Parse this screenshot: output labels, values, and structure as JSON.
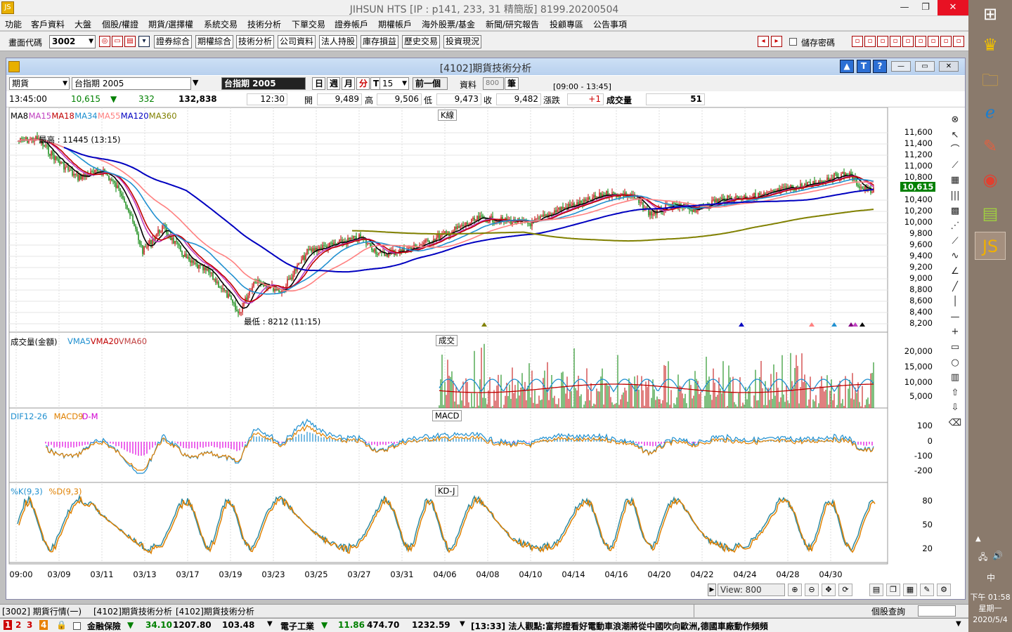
{
  "app": {
    "title": "JIHSUN HTS     [IP : p141, 233, 31 精簡版] 8199.20200504"
  },
  "menu": [
    "功能",
    "客戶資料",
    "大盤",
    "個股/權證",
    "期貨/選擇權",
    "系統交易",
    "技術分析",
    "下單交易",
    "證券帳戶",
    "期權帳戶",
    "海外股票/基金",
    "新聞/研究報告",
    "投顧專區",
    "公告事項"
  ],
  "toolbar": {
    "code_label": "畫面代碼",
    "code_value": "3002",
    "buttons": [
      "證券綜合",
      "期權綜合",
      "技術分析",
      "公司資料",
      "法人持股",
      "庫存損益",
      "歷史交易",
      "投資現況"
    ],
    "save_pwd": "儲存密碼"
  },
  "window": {
    "title": "[4102]期貨技術分析"
  },
  "controls": {
    "type": "期貨",
    "symbol": "台指期 2005",
    "symbol_name": "台指期 2005",
    "periods": [
      "日",
      "週",
      "月",
      "分",
      "T"
    ],
    "minutes": "15",
    "prev": "前一個",
    "data_label": "資料",
    "data_count": "800",
    "unit": "筆",
    "session": "[09:00 - 13:45]"
  },
  "quote": {
    "time": "13:45:00",
    "price": "10,615",
    "arrow": "▼",
    "change": "332",
    "volume": "132,838",
    "bar_time": "12:30",
    "open_lbl": "開",
    "open": "9,489",
    "high_lbl": "高",
    "high": "9,506",
    "low_lbl": "低",
    "low": "9,473",
    "close_lbl": "收",
    "close": "9,482",
    "chg_lbl": "漲跌",
    "chg": "+1",
    "vol_lbl": "成交量",
    "vol": "51"
  },
  "panels": {
    "k": {
      "title": "K線",
      "legend": [
        {
          "name": "MA8",
          "color": "#000000"
        },
        {
          "name": "MA15",
          "color": "#c040c0"
        },
        {
          "name": "MA18",
          "color": "#c00000"
        },
        {
          "name": "MA34",
          "color": "#2090d0"
        },
        {
          "name": "MA55",
          "color": "#ff8080"
        },
        {
          "name": "MA120",
          "color": "#0000c0"
        },
        {
          "name": "MA360",
          "color": "#808000"
        }
      ],
      "high_note": "最高 : 11445 (13:15)",
      "low_note": "最低 : 8212 (11:15)",
      "price_tag": "10,615",
      "yticks": [
        "11,600",
        "11,400",
        "11,200",
        "11,000",
        "10,800",
        "10,400",
        "10,200",
        "10,000",
        "9,800",
        "9,600",
        "9,400",
        "9,200",
        "9,000",
        "8,800",
        "8,600",
        "8,400",
        "8,200"
      ]
    },
    "vol": {
      "title": "成交",
      "legend": [
        {
          "name": "成交量(金額)",
          "color": "#000000"
        },
        {
          "name": "VMA5",
          "color": "#2090d0"
        },
        {
          "name": "VMA20",
          "color": "#c00000"
        },
        {
          "name": "VMA60",
          "color": "#c04040"
        }
      ],
      "yticks": [
        "20,000",
        "15,000",
        "10,000",
        "5,000"
      ]
    },
    "macd": {
      "title": "MACD",
      "legend": [
        {
          "name": "DIF12-26",
          "color": "#2090d0"
        },
        {
          "name": "MACD9",
          "color": "#e08000"
        },
        {
          "name": "D-M",
          "color": "#d000d0"
        }
      ],
      "yticks": [
        "100",
        "0",
        "-100",
        "-200"
      ]
    },
    "kd": {
      "title": "KD-J",
      "legend": [
        {
          "name": "%K(9,3)",
          "color": "#2090d0"
        },
        {
          "name": "%D(9,3)",
          "color": "#e08000"
        }
      ],
      "yticks": [
        "80",
        "50",
        "20"
      ]
    }
  },
  "xticks": [
    "09:00",
    "03/09",
    "03/11",
    "03/13",
    "03/17",
    "03/19",
    "03/23",
    "03/25",
    "03/27",
    "03/31",
    "04/06",
    "04/08",
    "04/10",
    "04/14",
    "04/16",
    "04/20",
    "04/22",
    "04/24",
    "04/28",
    "04/30"
  ],
  "view": "View: 800",
  "tabs": [
    "[3002] 期貨行情(一)",
    "[4102]期貨技術分析",
    "[4102]期貨技術分析"
  ],
  "stock_query": "個股查詢",
  "ticker": {
    "nums": [
      "1",
      "2",
      "3",
      "4"
    ],
    "sec1": "金融保險",
    "sec1_v1": "34.10",
    "sec1_v2": "1207.80",
    "sec1_v3": "103.48",
    "sec2": "電子工業",
    "sec2_v1": "11.86",
    "sec2_v2": "474.70",
    "sec2_v3": "1232.59",
    "news": "[13:33] 法人觀點:富邦證看好電動車浪潮將從中國吹向歐洲,德國車廠動作頻頻"
  },
  "clock": {
    "time": "下午 01:58",
    "day": "星期一",
    "date": "2020/5/4",
    "ime": "中"
  }
}
